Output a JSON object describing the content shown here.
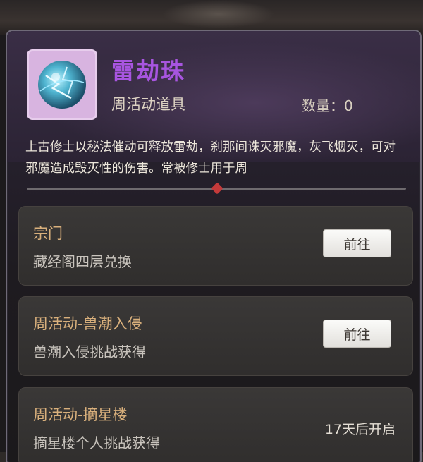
{
  "item": {
    "name": "雷劫珠",
    "type": "周活动道具",
    "quantity": "数量：0",
    "description": "上古修士以秘法催动可释放雷劫，刹那间诛灭邪魔，灰飞烟灭，可对邪魔造成毁灭性的伤害。常被修士用于周",
    "icon": "thunder-orb-icon"
  },
  "sources": [
    {
      "title": "宗门",
      "desc": "藏经阁四层兑换",
      "action": "前往"
    },
    {
      "title": "周活动-兽潮入侵",
      "desc": "兽潮入侵挑战获得",
      "action": "前往"
    },
    {
      "title": "周活动-摘星楼",
      "desc": "摘星楼个人挑战获得",
      "status": "17天后开启"
    }
  ],
  "colors": {
    "name": "#a855e0",
    "source_title": "#d9b07c",
    "scroll_thumb": "#c43a3a"
  }
}
